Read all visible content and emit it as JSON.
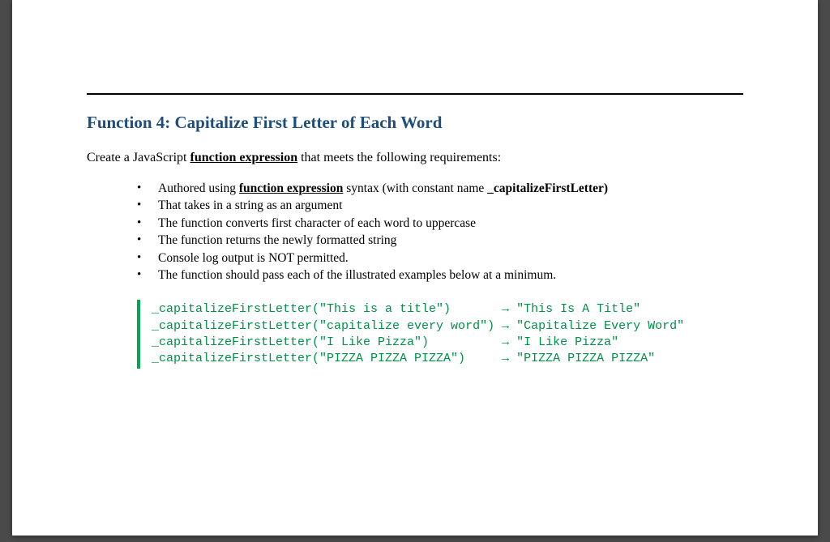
{
  "heading": "Function 4: Capitalize First Letter of Each Word",
  "intro": {
    "prefix": "Create a JavaScript ",
    "underlined": "function expression",
    "suffix": " that meets the following requirements:"
  },
  "requirements": [
    {
      "a": "Authored using ",
      "u": "function expression",
      "b": " syntax (with constant name ",
      "fn": "_capitalizeFirstLetter)",
      "c": ""
    },
    {
      "a": "That takes in a string as an argument"
    },
    {
      "a": "The function converts first character of each word to uppercase"
    },
    {
      "a": "The function returns the newly formatted string"
    },
    {
      "a": "Console log output is NOT permitted."
    },
    {
      "a": "The function should pass each of the illustrated examples below at a minimum."
    }
  ],
  "code": {
    "rows": [
      {
        "call": "_capitalizeFirstLetter(\"This is a title\")       ",
        "arrow": "→",
        "out": " \"This Is A Title\""
      },
      {
        "call": "_capitalizeFirstLetter(\"capitalize every word\") ",
        "arrow": "→",
        "out": " \"Capitalize Every Word\""
      },
      {
        "call": "_capitalizeFirstLetter(\"I Like Pizza\")          ",
        "arrow": "→",
        "out": " \"I Like Pizza\""
      },
      {
        "call": "_capitalizeFirstLetter(\"PIZZA PIZZA PIZZA\")     ",
        "arrow": "→",
        "out": " \"PIZZA PIZZA PIZZA\""
      }
    ]
  }
}
